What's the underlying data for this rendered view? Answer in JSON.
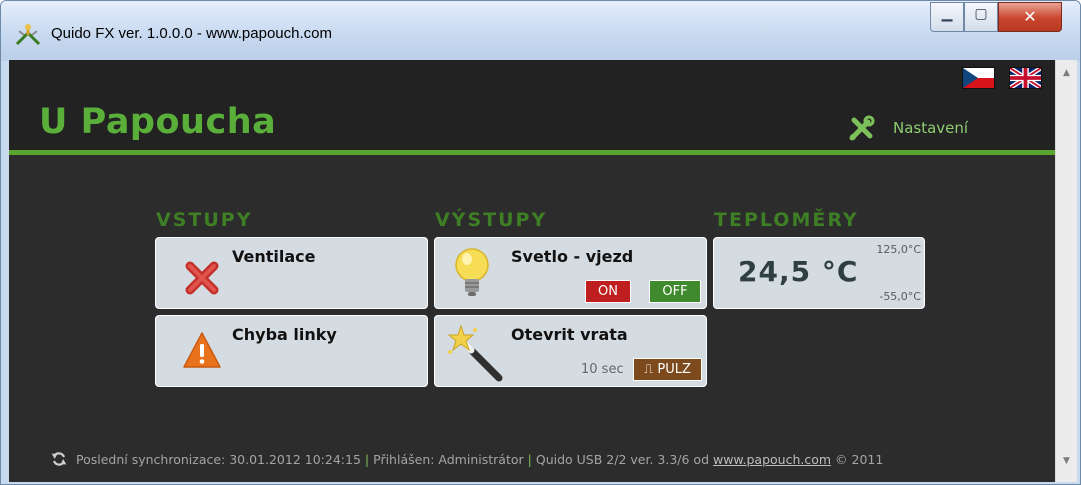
{
  "window": {
    "title": "Quido FX ver. 1.0.0.0 - www.papouch.com"
  },
  "header": {
    "site_title": "U Papoucha",
    "settings_label": "Nastavení",
    "flags": [
      "cz-flag-icon",
      "uk-flag-icon"
    ]
  },
  "sections": {
    "inputs": "VSTUPY",
    "outputs": "VÝSTUPY",
    "thermometers": "TEPLOMĚRY"
  },
  "inputs": [
    {
      "label": "Ventilace",
      "icon": "red-cross-icon"
    },
    {
      "label": "Chyba linky",
      "icon": "warning-icon"
    }
  ],
  "outputs": [
    {
      "label": "Svetlo - vjezd",
      "icon": "light-bulb-icon",
      "on_label": "ON",
      "off_label": "OFF"
    },
    {
      "label": "Otevrit vrata",
      "icon": "magic-wand-icon",
      "timer": "10 sec",
      "pulse_label": "⎍ PULZ"
    }
  ],
  "thermometer": {
    "value": "24,5 °C",
    "max": "125,0°C",
    "min": "-55,0°C"
  },
  "footer": {
    "sync_text": "Poslední synchronizace: 30.01.2012 10:24:15",
    "login_text": "Přihlášen: Administrátor",
    "device_text": "Quido USB 2/2 ver. 3.3/6 od",
    "link_text": "www.papouch.com",
    "copyright": "© 2011"
  },
  "colors": {
    "accent": "#5aae3a",
    "background": "#2c2c2c",
    "on": "#bf1e1e",
    "off": "#3f8a2d",
    "pulse": "#7d4a1e"
  }
}
